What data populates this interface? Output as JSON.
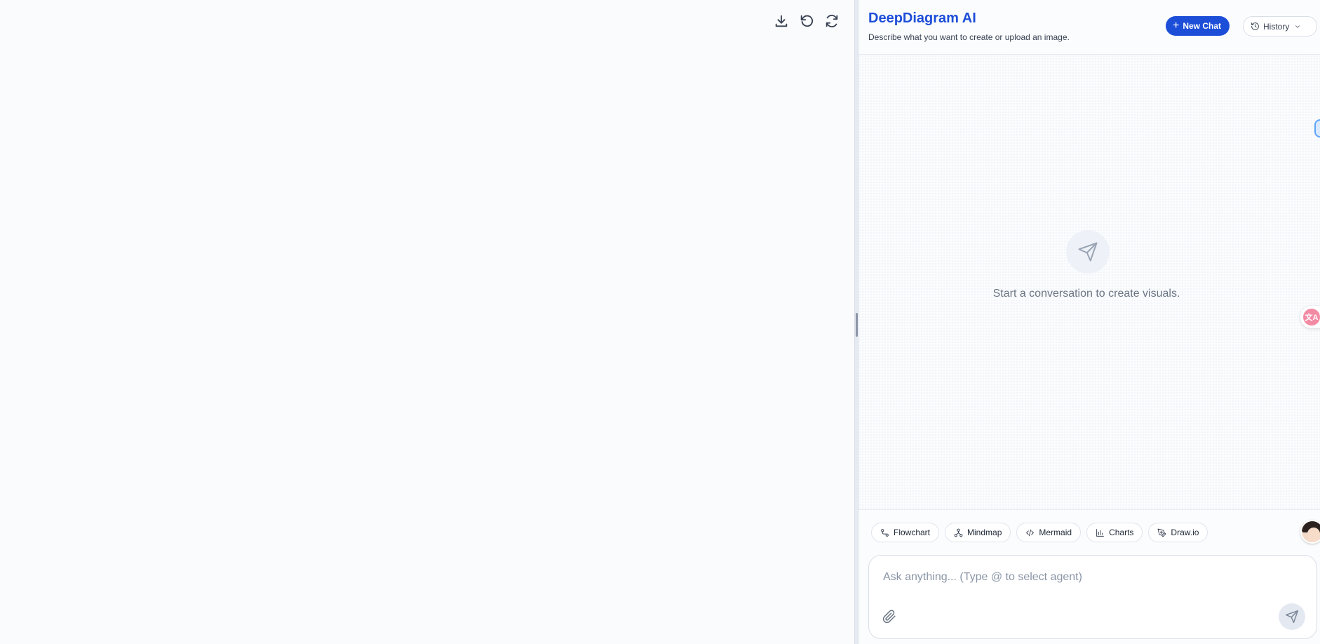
{
  "canvas": {
    "toolbar": [
      {
        "name": "download-icon"
      },
      {
        "name": "undo-icon"
      },
      {
        "name": "refresh-icon"
      }
    ]
  },
  "header": {
    "title": "DeepDiagram AI",
    "subtitle": "Describe what you want to create or upload an image.",
    "new_chat_label": "New Chat",
    "history_label": "History"
  },
  "chat": {
    "empty_message": "Start a conversation to create visuals.",
    "empty_icon": "send-icon"
  },
  "agents": [
    {
      "label": "Flowchart",
      "icon": "flowchart-icon"
    },
    {
      "label": "Mindmap",
      "icon": "mindmap-icon"
    },
    {
      "label": "Mermaid",
      "icon": "code-icon"
    },
    {
      "label": "Charts",
      "icon": "bar-chart-icon"
    },
    {
      "label": "Draw.io",
      "icon": "pen-icon"
    }
  ],
  "composer": {
    "placeholder": "Ask anything... (Type @ to select agent)",
    "value": ""
  },
  "colors": {
    "accent": "#1d4ed8",
    "background": "#fafbfd"
  }
}
